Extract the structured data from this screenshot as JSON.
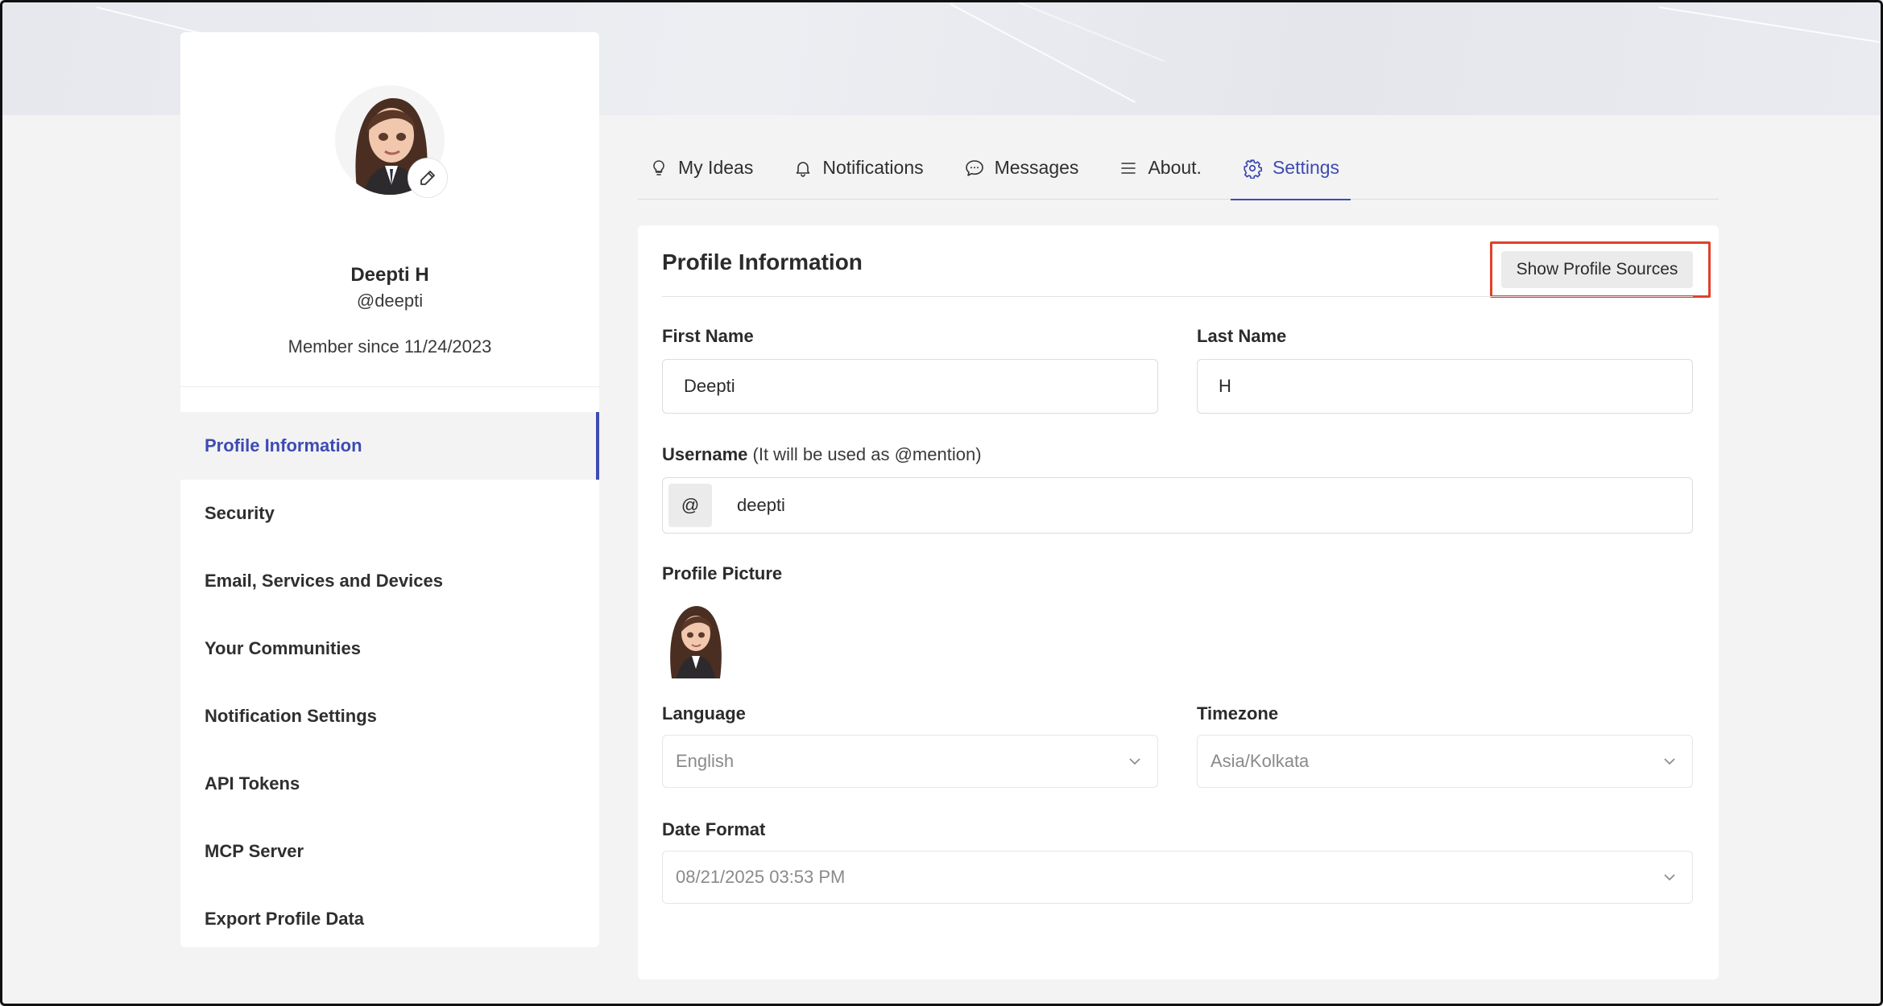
{
  "profile": {
    "name": "Deepti H",
    "handle": "@deepti",
    "member_since": "Member since 11/24/2023"
  },
  "sidebar": {
    "items": [
      {
        "label": "Profile Information",
        "active": true
      },
      {
        "label": "Security"
      },
      {
        "label": "Email, Services and Devices"
      },
      {
        "label": "Your Communities"
      },
      {
        "label": "Notification Settings"
      },
      {
        "label": "API Tokens"
      },
      {
        "label": "MCP Server"
      },
      {
        "label": "Export Profile Data"
      }
    ]
  },
  "tabs": [
    {
      "label": "My Ideas",
      "icon": "lightbulb-icon"
    },
    {
      "label": "Notifications",
      "icon": "bell-icon"
    },
    {
      "label": "Messages",
      "icon": "chat-bubble-icon"
    },
    {
      "label": "About.",
      "icon": "menu-lines-icon"
    },
    {
      "label": "Settings",
      "icon": "gear-icon",
      "active": true
    }
  ],
  "panel": {
    "title": "Profile Information",
    "show_sources_label": "Show Profile Sources",
    "first_name_label": "First Name",
    "first_name_value": "Deepti",
    "last_name_label": "Last Name",
    "last_name_value": "H",
    "username_label": "Username",
    "username_hint": "(It will be used as @mention)",
    "username_prefix": "@",
    "username_value": "deepti",
    "profile_picture_label": "Profile Picture",
    "language_label": "Language",
    "language_value": "English",
    "timezone_label": "Timezone",
    "timezone_value": "Asia/Kolkata",
    "date_format_label": "Date Format",
    "date_format_value": "08/21/2025 03:53 PM"
  },
  "colors": {
    "accent": "#3d4bb3",
    "highlight_outline": "#e0412a",
    "page_bg": "#f3f3f3"
  }
}
